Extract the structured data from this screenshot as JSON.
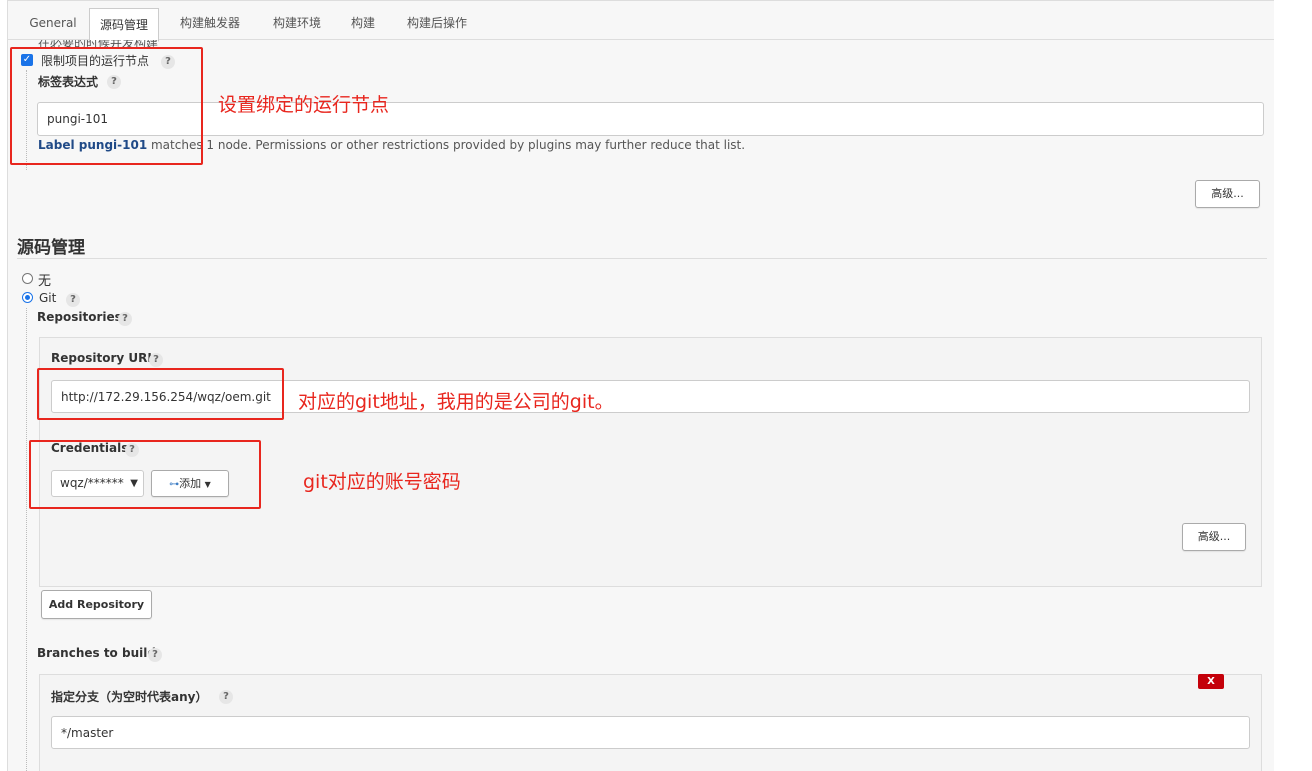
{
  "tabs": [
    "General",
    "源码管理",
    "构建触发器",
    "构建环境",
    "构建",
    "构建后操作"
  ],
  "top_cut_label": "在必要的时候并发构建",
  "restrict": {
    "checkbox_label": "限制项目的运行节点",
    "checked": true,
    "label_expr_title": "标签表达式",
    "label_value": "pungi-101",
    "match_link": "Label pungi-101",
    "match_text": " matches 1 node. Permissions or other restrictions provided by plugins may further reduce that list.",
    "advanced_button": "高级..."
  },
  "scm": {
    "heading": "源码管理",
    "option_none": "无",
    "option_git": "Git",
    "selected": "Git",
    "repositories_label": "Repositories",
    "repo_url_label": "Repository URL",
    "repo_url_value": "http://172.29.156.254/wqz/oem.git",
    "credentials_label": "Credentials",
    "credentials_value": "wqz/******",
    "add_button": "添加",
    "repo_advanced_button": "高级...",
    "add_repository_button": "Add Repository",
    "branches_label": "Branches to build",
    "branch_spec_label": "指定分支（为空时代表any）",
    "branch_value": "*/master",
    "delete_branch": "X"
  },
  "help_glyph": "?",
  "annotations": {
    "node": "设置绑定的运行节点",
    "git_url": "对应的git地址，我用的是公司的git。",
    "credentials": "git对应的账号密码"
  },
  "colors": {
    "annotation_red": "#e8261e",
    "link_blue": "#204a87",
    "delete_red": "#c4000a"
  }
}
